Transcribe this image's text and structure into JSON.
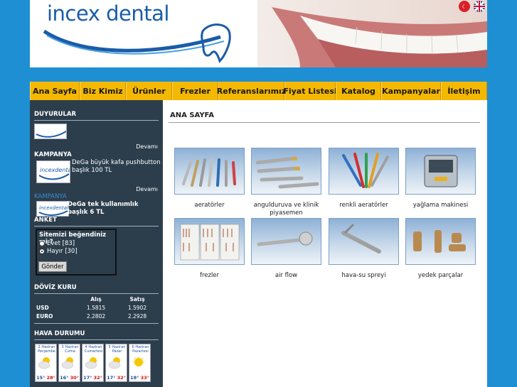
{
  "brand": {
    "logo_text": "incex dental"
  },
  "nav": {
    "items": [
      "Ana Sayfa",
      "Biz Kimiz",
      "Ürünler",
      "Frezler",
      "Referanslarımız",
      "Fiyat Listesi",
      "Katalog",
      "Kampanyalar",
      "İletişim"
    ]
  },
  "sidebar": {
    "duyurular": {
      "heading": "DUYURULAR",
      "devam": "Devamı"
    },
    "kampanya": {
      "heading": "KAMPANYA",
      "item1": "DeGa büyük kafa pushbutton başlık 100 TL",
      "devam": "Devamı",
      "overlay_label": "KAMPANYA",
      "item2": "DeGa tek kullanımlık başlık 6 TL"
    },
    "anket": {
      "heading": "ANKET",
      "question": "Sitemizi beğendiniz mi ?",
      "options": [
        "Evet [83]",
        "Hayır [30]"
      ],
      "submit": "Gönder"
    },
    "doviz": {
      "heading": "DÖVİZ KURU",
      "headers": [
        "",
        "Alış",
        "Satış"
      ],
      "rows": [
        [
          "USD",
          "1.5815",
          "1.5902"
        ],
        [
          "EURO",
          "2.2802",
          "2.2928"
        ]
      ]
    },
    "hava": {
      "heading": "HAVA DURUMU",
      "days": [
        {
          "date": "2 Haziran",
          "day": "Perşembe",
          "lo": "15°",
          "hi": "28°"
        },
        {
          "date": "3 Haziran",
          "day": "Cuma",
          "lo": "16°",
          "hi": "30°"
        },
        {
          "date": "4 Haziran",
          "day": "Cumartesi",
          "lo": "17°",
          "hi": "32°"
        },
        {
          "date": "5 Haziran",
          "day": "Pazar",
          "lo": "17°",
          "hi": "32°"
        },
        {
          "date": "6 Haziran",
          "day": "Pazartesi",
          "lo": "18°",
          "hi": "33°"
        }
      ]
    }
  },
  "main": {
    "title": "ANA SAYFA",
    "products": [
      "aeratörler",
      "angulduruva ve klinik piyasemen",
      "renkli aeratörler",
      "yağlama makinesi",
      "frezler",
      "air flow",
      "hava-su spreyi",
      "yedek parçalar"
    ]
  },
  "colors": {
    "nav_bg": "#f5b800",
    "sidebar_bg": "#2c3e4c",
    "page_bg": "#1f8fd3",
    "brand_blue": "#1a5ca8"
  }
}
